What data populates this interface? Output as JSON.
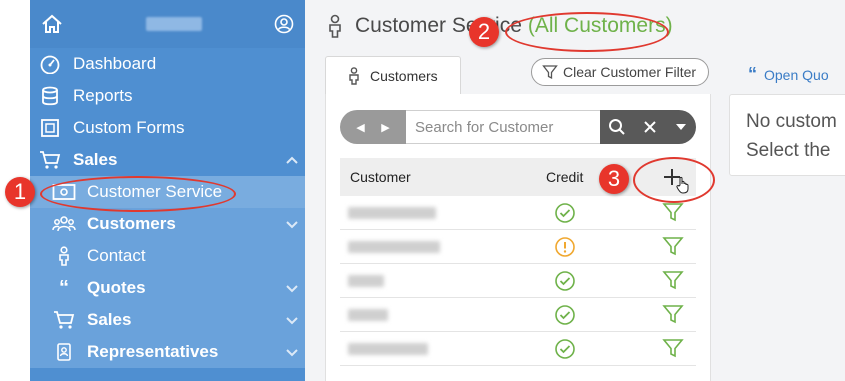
{
  "sidebar": {
    "items": [
      {
        "label": "Dashboard",
        "icon": "gauge-icon"
      },
      {
        "label": "Reports",
        "icon": "database-icon"
      },
      {
        "label": "Custom Forms",
        "icon": "form-icon"
      },
      {
        "label": "Sales",
        "icon": "cart-icon"
      }
    ],
    "sub_items": [
      {
        "label": "Customer Service",
        "icon": "cash-icon"
      },
      {
        "label": "Customers",
        "icon": "people-icon"
      },
      {
        "label": "Contact",
        "icon": "person-icon"
      },
      {
        "label": "Quotes",
        "icon": "quote-icon"
      },
      {
        "label": "Sales",
        "icon": "cart-icon"
      },
      {
        "label": "Representatives",
        "icon": "badge-icon"
      }
    ]
  },
  "header": {
    "title": "Customer Service",
    "filter_label": "(All Customers)"
  },
  "tabs": {
    "customers_label": "Customers"
  },
  "toolbar": {
    "clear_filter_label": "Clear Customer Filter",
    "open_quotes_label": "Open Quo"
  },
  "search": {
    "placeholder": "Search for Customer"
  },
  "table": {
    "columns": [
      "Customer",
      "Credit"
    ],
    "rows": [
      {
        "credit_status": "ok"
      },
      {
        "credit_status": "warning"
      },
      {
        "credit_status": "ok"
      },
      {
        "credit_status": "ok"
      },
      {
        "credit_status": "ok"
      }
    ]
  },
  "right_panel": {
    "line1": "No custom",
    "line2": "Select the"
  },
  "annotations": [
    "1",
    "2",
    "3"
  ],
  "colors": {
    "sidebar": "#4f8fd1",
    "ok": "#6fb24a",
    "warning": "#f0a830",
    "annotation": "#e8352b",
    "link": "#3a7cc6"
  }
}
